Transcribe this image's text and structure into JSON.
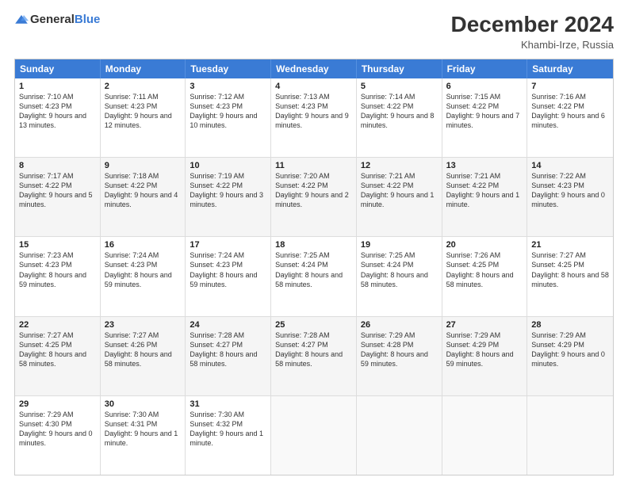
{
  "logo": {
    "text_general": "General",
    "text_blue": "Blue"
  },
  "title": "December 2024",
  "location": "Khambi-Irze, Russia",
  "days_of_week": [
    "Sunday",
    "Monday",
    "Tuesday",
    "Wednesday",
    "Thursday",
    "Friday",
    "Saturday"
  ],
  "weeks": [
    [
      {
        "day": "1",
        "sunrise": "7:10 AM",
        "sunset": "4:23 PM",
        "daylight": "9 hours and 13 minutes."
      },
      {
        "day": "2",
        "sunrise": "7:11 AM",
        "sunset": "4:23 PM",
        "daylight": "9 hours and 12 minutes."
      },
      {
        "day": "3",
        "sunrise": "7:12 AM",
        "sunset": "4:23 PM",
        "daylight": "9 hours and 10 minutes."
      },
      {
        "day": "4",
        "sunrise": "7:13 AM",
        "sunset": "4:23 PM",
        "daylight": "9 hours and 9 minutes."
      },
      {
        "day": "5",
        "sunrise": "7:14 AM",
        "sunset": "4:22 PM",
        "daylight": "9 hours and 8 minutes."
      },
      {
        "day": "6",
        "sunrise": "7:15 AM",
        "sunset": "4:22 PM",
        "daylight": "9 hours and 7 minutes."
      },
      {
        "day": "7",
        "sunrise": "7:16 AM",
        "sunset": "4:22 PM",
        "daylight": "9 hours and 6 minutes."
      }
    ],
    [
      {
        "day": "8",
        "sunrise": "7:17 AM",
        "sunset": "4:22 PM",
        "daylight": "9 hours and 5 minutes."
      },
      {
        "day": "9",
        "sunrise": "7:18 AM",
        "sunset": "4:22 PM",
        "daylight": "9 hours and 4 minutes."
      },
      {
        "day": "10",
        "sunrise": "7:19 AM",
        "sunset": "4:22 PM",
        "daylight": "9 hours and 3 minutes."
      },
      {
        "day": "11",
        "sunrise": "7:20 AM",
        "sunset": "4:22 PM",
        "daylight": "9 hours and 2 minutes."
      },
      {
        "day": "12",
        "sunrise": "7:21 AM",
        "sunset": "4:22 PM",
        "daylight": "9 hours and 1 minute."
      },
      {
        "day": "13",
        "sunrise": "7:21 AM",
        "sunset": "4:22 PM",
        "daylight": "9 hours and 1 minute."
      },
      {
        "day": "14",
        "sunrise": "7:22 AM",
        "sunset": "4:23 PM",
        "daylight": "9 hours and 0 minutes."
      }
    ],
    [
      {
        "day": "15",
        "sunrise": "7:23 AM",
        "sunset": "4:23 PM",
        "daylight": "8 hours and 59 minutes."
      },
      {
        "day": "16",
        "sunrise": "7:24 AM",
        "sunset": "4:23 PM",
        "daylight": "8 hours and 59 minutes."
      },
      {
        "day": "17",
        "sunrise": "7:24 AM",
        "sunset": "4:23 PM",
        "daylight": "8 hours and 59 minutes."
      },
      {
        "day": "18",
        "sunrise": "7:25 AM",
        "sunset": "4:24 PM",
        "daylight": "8 hours and 58 minutes."
      },
      {
        "day": "19",
        "sunrise": "7:25 AM",
        "sunset": "4:24 PM",
        "daylight": "8 hours and 58 minutes."
      },
      {
        "day": "20",
        "sunrise": "7:26 AM",
        "sunset": "4:25 PM",
        "daylight": "8 hours and 58 minutes."
      },
      {
        "day": "21",
        "sunrise": "7:27 AM",
        "sunset": "4:25 PM",
        "daylight": "8 hours and 58 minutes."
      }
    ],
    [
      {
        "day": "22",
        "sunrise": "7:27 AM",
        "sunset": "4:25 PM",
        "daylight": "8 hours and 58 minutes."
      },
      {
        "day": "23",
        "sunrise": "7:27 AM",
        "sunset": "4:26 PM",
        "daylight": "8 hours and 58 minutes."
      },
      {
        "day": "24",
        "sunrise": "7:28 AM",
        "sunset": "4:27 PM",
        "daylight": "8 hours and 58 minutes."
      },
      {
        "day": "25",
        "sunrise": "7:28 AM",
        "sunset": "4:27 PM",
        "daylight": "8 hours and 58 minutes."
      },
      {
        "day": "26",
        "sunrise": "7:29 AM",
        "sunset": "4:28 PM",
        "daylight": "8 hours and 59 minutes."
      },
      {
        "day": "27",
        "sunrise": "7:29 AM",
        "sunset": "4:29 PM",
        "daylight": "8 hours and 59 minutes."
      },
      {
        "day": "28",
        "sunrise": "7:29 AM",
        "sunset": "4:29 PM",
        "daylight": "9 hours and 0 minutes."
      }
    ],
    [
      {
        "day": "29",
        "sunrise": "7:29 AM",
        "sunset": "4:30 PM",
        "daylight": "9 hours and 0 minutes."
      },
      {
        "day": "30",
        "sunrise": "7:30 AM",
        "sunset": "4:31 PM",
        "daylight": "9 hours and 1 minute."
      },
      {
        "day": "31",
        "sunrise": "7:30 AM",
        "sunset": "4:32 PM",
        "daylight": "9 hours and 1 minute."
      },
      null,
      null,
      null,
      null
    ]
  ]
}
